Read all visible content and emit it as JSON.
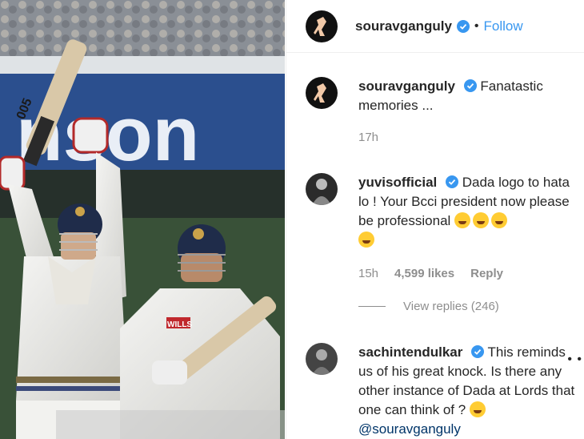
{
  "post": {
    "author": "souravganguly",
    "separator": "•",
    "follow_label": "Follow"
  },
  "comments": [
    {
      "user": "souravganguly",
      "text": "Fanatastic memories ...",
      "time": "17h"
    },
    {
      "user": "yuvisofficial",
      "text": "Dada logo to hata lo ! Your Bcci president now please be professional",
      "time": "15h",
      "likes": "4,599 likes",
      "reply_label": "Reply",
      "view_replies": "View replies (246)"
    },
    {
      "user": "sachintendulkar",
      "text": "This reminds us of his great knock. Is there any other instance of Dada at Lords that one can think of ?",
      "mention": "@souravganguly"
    }
  ],
  "more_options": "• •",
  "photo": {
    "banner_text": "nson",
    "bat_text": "005",
    "jersey_text": "WILLS"
  },
  "colors": {
    "link": "#3897f0",
    "muted": "#8e8e8e",
    "text": "#262626",
    "verified": "#3897f0"
  }
}
